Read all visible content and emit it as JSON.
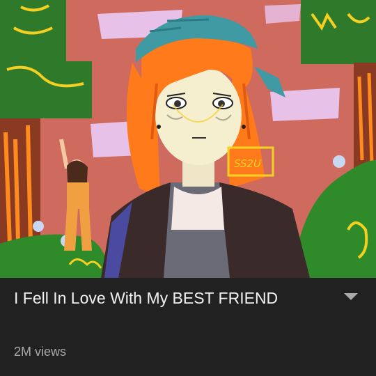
{
  "video": {
    "title": "I Fell In Love With My BEST FRIEND",
    "views": "2M views",
    "thumbnail_text": "SS2U"
  },
  "icons": {
    "expand": "chevron-down-icon"
  },
  "colors": {
    "background": "#212121",
    "title": "#f1f1f1",
    "meta": "#aaaaaa",
    "thumbnail_bg": "#cf6a5e"
  }
}
